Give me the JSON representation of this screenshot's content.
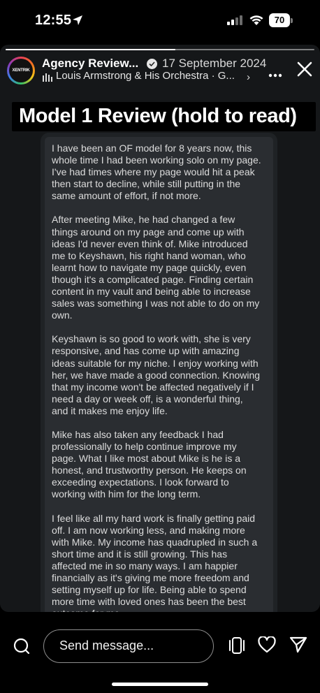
{
  "status_bar": {
    "time": "12:55",
    "battery": "70"
  },
  "story": {
    "progress": 0.55,
    "avatar_logo": "XENTRIK",
    "account_name": "Agency Review...",
    "date": "17 September 2024",
    "music": "Louis Armstrong & His Orchestra · G...",
    "banner_title": "Model 1 Review (hold to read)",
    "review_paragraphs": [
      "I have been an OF model for 8 years now, this whole time I had been working solo on my page. I've had times where my page would hit a peak then start to decline, while still putting in the same amount of effort, if not more.",
      "After meeting Mike, he had changed a few things around on my page and come up with ideas I'd never even think of. Mike introduced me to Keyshawn, his right hand woman, who learnt how to navigate my page quickly, even though it's a complicated page. Finding certain content in my vault and being able to increase sales was something I was not able to do on my own.",
      "Keyshawn is so good to work with, she is very responsive, and has come up with amazing ideas suitable for my niche. I enjoy working with her, we have made a good connection. Knowing that my income won't be affected negatively if I need a day or week off, is a wonderful thing, and it makes me enjoy life.",
      "Mike has also taken any feedback I had professionally to help continue improve my page.  What I like most about Mike is he is a honest, and trustworthy person. He keeps on exceeding expectations. I look forward to working with him for the long term.",
      "I feel like all my hard work is finally getting paid off. I am now working less, and making more with Mike. My income has quadrupled in such a short time and it is still growing. This has affected me in so many ways. I am happier financially as it's giving me more freedom and setting myself up for life. Being able to spend more time with loved ones has been the best outcome for me."
    ]
  },
  "bottom_bar": {
    "message_placeholder": "Send message..."
  },
  "icons": {
    "location": "location-arrow-icon",
    "signal": "cellular-signal-icon",
    "wifi": "wifi-icon",
    "verified": "verified-badge-icon",
    "music": "music-bars-icon",
    "more": "more-horizontal-icon",
    "close": "close-icon",
    "camera": "camera-icon",
    "stickers": "stickers-icon",
    "like": "heart-icon",
    "send": "send-icon"
  }
}
